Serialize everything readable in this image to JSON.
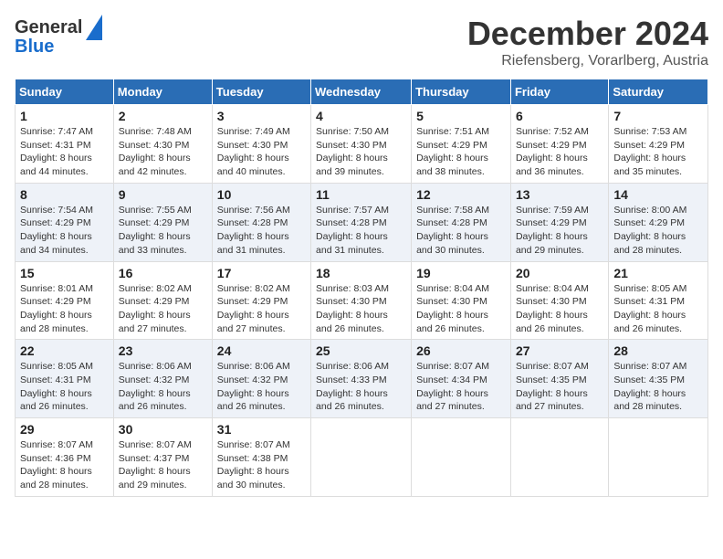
{
  "header": {
    "logo_general": "General",
    "logo_blue": "Blue",
    "month_title": "December 2024",
    "location": "Riefensberg, Vorarlberg, Austria"
  },
  "columns": [
    "Sunday",
    "Monday",
    "Tuesday",
    "Wednesday",
    "Thursday",
    "Friday",
    "Saturday"
  ],
  "weeks": [
    [
      {
        "day": "1",
        "sunrise": "Sunrise: 7:47 AM",
        "sunset": "Sunset: 4:31 PM",
        "daylight": "Daylight: 8 hours and 44 minutes."
      },
      {
        "day": "2",
        "sunrise": "Sunrise: 7:48 AM",
        "sunset": "Sunset: 4:30 PM",
        "daylight": "Daylight: 8 hours and 42 minutes."
      },
      {
        "day": "3",
        "sunrise": "Sunrise: 7:49 AM",
        "sunset": "Sunset: 4:30 PM",
        "daylight": "Daylight: 8 hours and 40 minutes."
      },
      {
        "day": "4",
        "sunrise": "Sunrise: 7:50 AM",
        "sunset": "Sunset: 4:30 PM",
        "daylight": "Daylight: 8 hours and 39 minutes."
      },
      {
        "day": "5",
        "sunrise": "Sunrise: 7:51 AM",
        "sunset": "Sunset: 4:29 PM",
        "daylight": "Daylight: 8 hours and 38 minutes."
      },
      {
        "day": "6",
        "sunrise": "Sunrise: 7:52 AM",
        "sunset": "Sunset: 4:29 PM",
        "daylight": "Daylight: 8 hours and 36 minutes."
      },
      {
        "day": "7",
        "sunrise": "Sunrise: 7:53 AM",
        "sunset": "Sunset: 4:29 PM",
        "daylight": "Daylight: 8 hours and 35 minutes."
      }
    ],
    [
      {
        "day": "8",
        "sunrise": "Sunrise: 7:54 AM",
        "sunset": "Sunset: 4:29 PM",
        "daylight": "Daylight: 8 hours and 34 minutes."
      },
      {
        "day": "9",
        "sunrise": "Sunrise: 7:55 AM",
        "sunset": "Sunset: 4:29 PM",
        "daylight": "Daylight: 8 hours and 33 minutes."
      },
      {
        "day": "10",
        "sunrise": "Sunrise: 7:56 AM",
        "sunset": "Sunset: 4:28 PM",
        "daylight": "Daylight: 8 hours and 31 minutes."
      },
      {
        "day": "11",
        "sunrise": "Sunrise: 7:57 AM",
        "sunset": "Sunset: 4:28 PM",
        "daylight": "Daylight: 8 hours and 31 minutes."
      },
      {
        "day": "12",
        "sunrise": "Sunrise: 7:58 AM",
        "sunset": "Sunset: 4:28 PM",
        "daylight": "Daylight: 8 hours and 30 minutes."
      },
      {
        "day": "13",
        "sunrise": "Sunrise: 7:59 AM",
        "sunset": "Sunset: 4:29 PM",
        "daylight": "Daylight: 8 hours and 29 minutes."
      },
      {
        "day": "14",
        "sunrise": "Sunrise: 8:00 AM",
        "sunset": "Sunset: 4:29 PM",
        "daylight": "Daylight: 8 hours and 28 minutes."
      }
    ],
    [
      {
        "day": "15",
        "sunrise": "Sunrise: 8:01 AM",
        "sunset": "Sunset: 4:29 PM",
        "daylight": "Daylight: 8 hours and 28 minutes."
      },
      {
        "day": "16",
        "sunrise": "Sunrise: 8:02 AM",
        "sunset": "Sunset: 4:29 PM",
        "daylight": "Daylight: 8 hours and 27 minutes."
      },
      {
        "day": "17",
        "sunrise": "Sunrise: 8:02 AM",
        "sunset": "Sunset: 4:29 PM",
        "daylight": "Daylight: 8 hours and 27 minutes."
      },
      {
        "day": "18",
        "sunrise": "Sunrise: 8:03 AM",
        "sunset": "Sunset: 4:30 PM",
        "daylight": "Daylight: 8 hours and 26 minutes."
      },
      {
        "day": "19",
        "sunrise": "Sunrise: 8:04 AM",
        "sunset": "Sunset: 4:30 PM",
        "daylight": "Daylight: 8 hours and 26 minutes."
      },
      {
        "day": "20",
        "sunrise": "Sunrise: 8:04 AM",
        "sunset": "Sunset: 4:30 PM",
        "daylight": "Daylight: 8 hours and 26 minutes."
      },
      {
        "day": "21",
        "sunrise": "Sunrise: 8:05 AM",
        "sunset": "Sunset: 4:31 PM",
        "daylight": "Daylight: 8 hours and 26 minutes."
      }
    ],
    [
      {
        "day": "22",
        "sunrise": "Sunrise: 8:05 AM",
        "sunset": "Sunset: 4:31 PM",
        "daylight": "Daylight: 8 hours and 26 minutes."
      },
      {
        "day": "23",
        "sunrise": "Sunrise: 8:06 AM",
        "sunset": "Sunset: 4:32 PM",
        "daylight": "Daylight: 8 hours and 26 minutes."
      },
      {
        "day": "24",
        "sunrise": "Sunrise: 8:06 AM",
        "sunset": "Sunset: 4:32 PM",
        "daylight": "Daylight: 8 hours and 26 minutes."
      },
      {
        "day": "25",
        "sunrise": "Sunrise: 8:06 AM",
        "sunset": "Sunset: 4:33 PM",
        "daylight": "Daylight: 8 hours and 26 minutes."
      },
      {
        "day": "26",
        "sunrise": "Sunrise: 8:07 AM",
        "sunset": "Sunset: 4:34 PM",
        "daylight": "Daylight: 8 hours and 27 minutes."
      },
      {
        "day": "27",
        "sunrise": "Sunrise: 8:07 AM",
        "sunset": "Sunset: 4:35 PM",
        "daylight": "Daylight: 8 hours and 27 minutes."
      },
      {
        "day": "28",
        "sunrise": "Sunrise: 8:07 AM",
        "sunset": "Sunset: 4:35 PM",
        "daylight": "Daylight: 8 hours and 28 minutes."
      }
    ],
    [
      {
        "day": "29",
        "sunrise": "Sunrise: 8:07 AM",
        "sunset": "Sunset: 4:36 PM",
        "daylight": "Daylight: 8 hours and 28 minutes."
      },
      {
        "day": "30",
        "sunrise": "Sunrise: 8:07 AM",
        "sunset": "Sunset: 4:37 PM",
        "daylight": "Daylight: 8 hours and 29 minutes."
      },
      {
        "day": "31",
        "sunrise": "Sunrise: 8:07 AM",
        "sunset": "Sunset: 4:38 PM",
        "daylight": "Daylight: 8 hours and 30 minutes."
      },
      null,
      null,
      null,
      null
    ]
  ]
}
